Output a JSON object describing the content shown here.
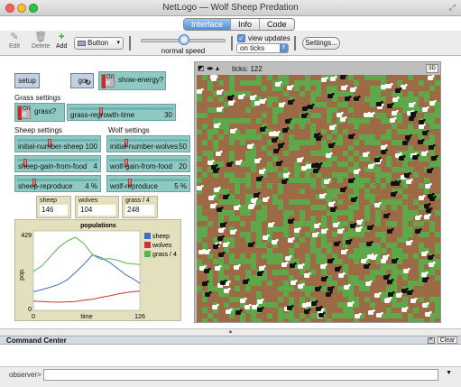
{
  "window": {
    "title": "NetLogo — Wolf Sheep Predation"
  },
  "tabs": [
    {
      "label": "Interface",
      "active": true
    },
    {
      "label": "Info",
      "active": false
    },
    {
      "label": "Code",
      "active": false
    }
  ],
  "toolbar": {
    "edit_label": "Edit",
    "delete_label": "Delete",
    "add_label": "Add",
    "widget_type": "Button",
    "speed_label": "normal speed",
    "speed_value": 0.5,
    "view_updates_label": "view updates",
    "view_updates_checked": true,
    "update_mode": "on ticks",
    "settings_label": "Settings..."
  },
  "buttons": {
    "setup": "setup",
    "go": "go"
  },
  "switches": {
    "show_energy": {
      "label": "show-energy?",
      "on_label": "On",
      "off_label": "Off",
      "value": false
    },
    "grass": {
      "label": "grass?",
      "on_label": "On",
      "off_label": "Off",
      "value": false
    }
  },
  "sections": {
    "grass": "Grass settings",
    "sheep": "Sheep settings",
    "wolf": "Wolf settings"
  },
  "sliders": {
    "grass_regrowth_time": {
      "name": "grass-regrowth-time",
      "value": "30",
      "fraction": 0.3
    },
    "initial_number_sheep": {
      "name": "initial-number-sheep",
      "value": "100",
      "fraction": 0.4
    },
    "sheep_gain_from_food": {
      "name": "sheep-gain-from-food",
      "value": "4",
      "fraction": 0.08
    },
    "sheep_reproduce": {
      "name": "sheep-reproduce",
      "value": "4 %",
      "fraction": 0.2
    },
    "initial_number_wolves": {
      "name": "initial-number-wolves",
      "value": "50",
      "fraction": 0.2
    },
    "wolf_gain_from_food": {
      "name": "wolf-gain-from-food",
      "value": "20",
      "fraction": 0.2
    },
    "wolf_reproduce": {
      "name": "wolf-reproduce",
      "value": "5 %",
      "fraction": 0.25
    }
  },
  "monitors": {
    "sheep": {
      "label": "sheep",
      "value": "146"
    },
    "wolves": {
      "label": "wolves",
      "value": "104"
    },
    "grass": {
      "label": "grass / 4",
      "value": "248"
    }
  },
  "plot": {
    "title": "populations",
    "ylabel": "pop.",
    "xlabel": "time",
    "ymin_label": "0",
    "ymax_label": "429",
    "xmin_label": "0",
    "xmax_label": "126",
    "legend": [
      {
        "name": "sheep",
        "color": "#3d6fc2"
      },
      {
        "name": "wolves",
        "color": "#d03030"
      },
      {
        "name": "grass / 4",
        "color": "#55b84a"
      }
    ]
  },
  "chart_data": {
    "type": "line",
    "title": "populations",
    "xlabel": "time",
    "ylabel": "pop.",
    "xlim": [
      0,
      126
    ],
    "ylim": [
      0,
      429
    ],
    "series": [
      {
        "name": "sheep",
        "color": "#3d6fc2",
        "x": [
          0,
          10,
          20,
          30,
          40,
          50,
          60,
          70,
          80,
          90,
          100,
          110,
          120,
          126
        ],
        "y": [
          100,
          112,
          125,
          140,
          165,
          205,
          250,
          300,
          285,
          260,
          225,
          190,
          165,
          146
        ]
      },
      {
        "name": "wolves",
        "color": "#d03030",
        "x": [
          0,
          10,
          20,
          30,
          40,
          50,
          60,
          70,
          80,
          90,
          100,
          110,
          120,
          126
        ],
        "y": [
          50,
          48,
          45,
          44,
          46,
          48,
          55,
          60,
          70,
          78,
          88,
          96,
          102,
          104
        ]
      },
      {
        "name": "grass / 4",
        "color": "#55b84a",
        "x": [
          0,
          10,
          20,
          30,
          40,
          50,
          60,
          70,
          80,
          90,
          100,
          110,
          120,
          126
        ],
        "y": [
          210,
          240,
          290,
          340,
          375,
          395,
          360,
          300,
          275,
          280,
          270,
          255,
          250,
          248
        ]
      }
    ]
  },
  "world": {
    "ticks_label": "ticks: 122",
    "btn_3d": "3D",
    "colors": {
      "dirt": "#9c6b45",
      "grass": "#5ea84a",
      "sheep": "#ffffff",
      "wolf": "#111111"
    },
    "agent_counts": {
      "sheep": 146,
      "wolves": 104
    }
  },
  "command_center": {
    "title": "Command Center",
    "clear_label": "Clear",
    "observer_label": "observer>"
  }
}
